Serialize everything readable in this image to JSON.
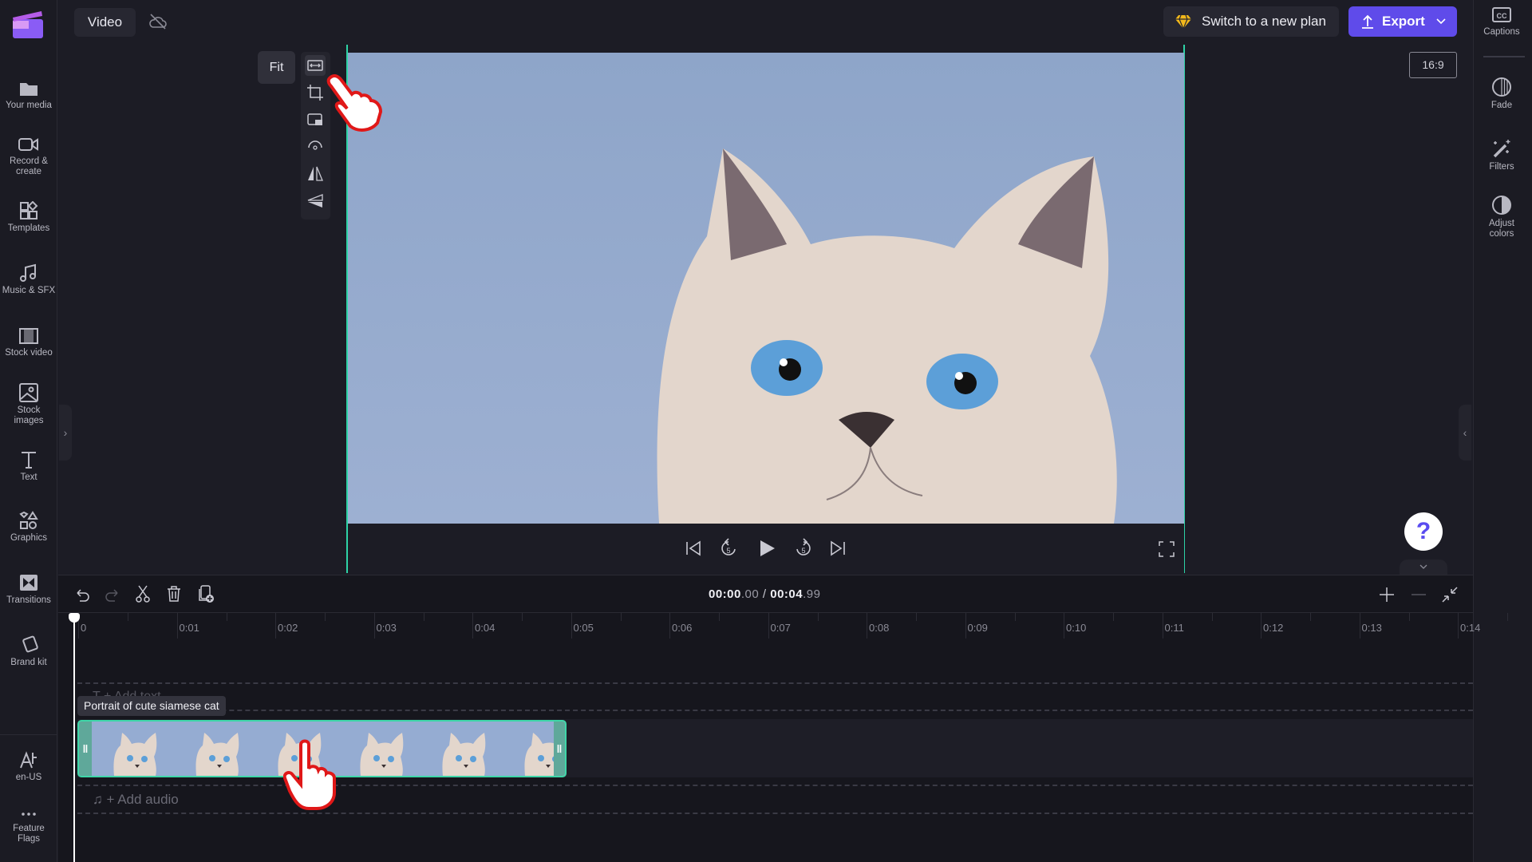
{
  "app": {
    "tab": "Video",
    "cloud_icon": "cloud-off-icon",
    "accent": "#5f4bea",
    "teal": "#2ed3a6"
  },
  "header": {
    "upgrade_label": "Switch to a new plan",
    "export_label": "Export",
    "aspect_ratio": "16:9"
  },
  "left_sidebar": {
    "items": [
      {
        "label": "Your media",
        "icon": "folder-icon"
      },
      {
        "label": "Record & create",
        "icon": "camera-icon"
      },
      {
        "label": "Templates",
        "icon": "templates-icon"
      },
      {
        "label": "Music & SFX",
        "icon": "music-icon"
      },
      {
        "label": "Stock video",
        "icon": "film-icon"
      },
      {
        "label": "Stock images",
        "icon": "image-icon"
      },
      {
        "label": "Text",
        "icon": "text-icon"
      },
      {
        "label": "Graphics",
        "icon": "shapes-icon"
      },
      {
        "label": "Transitions",
        "icon": "transition-icon"
      },
      {
        "label": "Brand kit",
        "icon": "brand-icon"
      }
    ],
    "bottom": [
      {
        "label": "en-US",
        "icon": "language-icon"
      },
      {
        "label": "Feature Flags",
        "icon": "more-icon"
      }
    ]
  },
  "right_sidebar": {
    "items": [
      {
        "label": "Captions",
        "icon": "cc-icon"
      },
      {
        "label": "Fade",
        "icon": "fade-icon"
      },
      {
        "label": "Filters",
        "icon": "wand-icon"
      },
      {
        "label": "Adjust colors",
        "icon": "contrast-icon"
      }
    ]
  },
  "preview_toolbar": {
    "tooltip": "Fit",
    "tools": [
      "fit-icon",
      "crop-icon",
      "pip-icon",
      "rotate-icon",
      "flip-horizontal-icon",
      "flip-vertical-icon"
    ]
  },
  "playback": {
    "controls": [
      "skip-back-icon",
      "rewind-5-icon",
      "play-icon",
      "forward-5-icon",
      "skip-forward-icon"
    ],
    "fullscreen": "fullscreen-icon"
  },
  "timeline": {
    "current_time": "00:00",
    "current_frac": ".00",
    "sep": "/",
    "total_time": "00:04",
    "total_frac": ".99",
    "ruler": [
      "0",
      "0:01",
      "0:02",
      "0:03",
      "0:04",
      "0:05",
      "0:06",
      "0:07",
      "0:08",
      "0:09",
      "0:10",
      "0:11",
      "0:12",
      "0:13",
      "0:14"
    ],
    "text_track": "+ Add text",
    "clip_title": "Portrait of cute siamese cat",
    "audio_track": "+ Add audio"
  }
}
